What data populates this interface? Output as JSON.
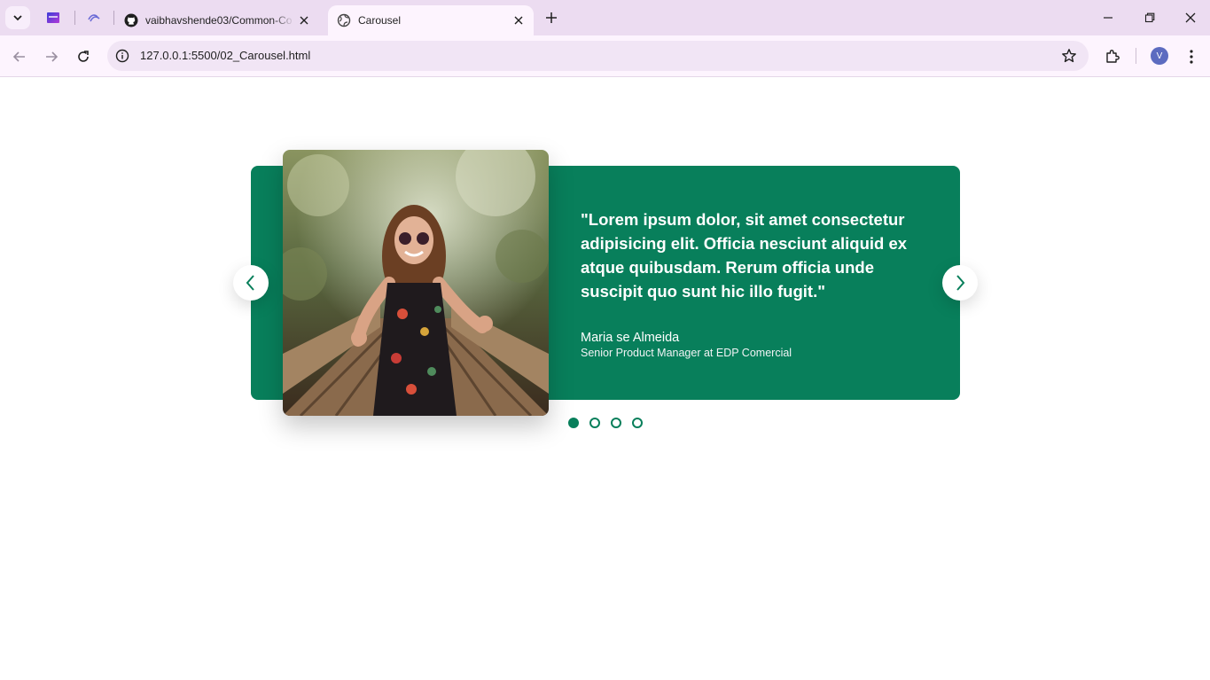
{
  "browser": {
    "tabs": [
      {
        "title": "vaibhavshende03/Common-Co",
        "active": false,
        "icon": "github-icon"
      },
      {
        "title": "Carousel",
        "active": true,
        "icon": "globe-icon"
      }
    ],
    "url": "127.0.0.1:5500/02_Carousel.html",
    "profile_initial": "V"
  },
  "testimonial": {
    "quote": "\"Lorem ipsum dolor, sit amet consectetur adipisicing elit. Officia nesciunt aliquid ex atque quibusdam. Rerum officia unde suscipit quo sunt hic illo fugit.\"",
    "author": "Maria se Almeida",
    "job": "Senior Product Manager at EDP Comercial"
  },
  "carousel": {
    "slide_count": 4,
    "active_index": 0
  },
  "colors": {
    "accent": "#087f5b",
    "tabstrip": "#ecdcf1",
    "toolbar": "#fdf4fe"
  }
}
